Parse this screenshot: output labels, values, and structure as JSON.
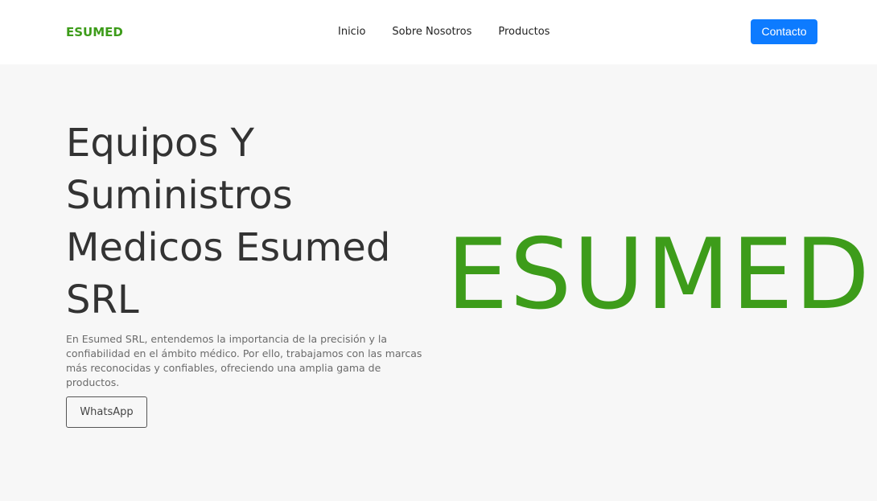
{
  "header": {
    "brand": "ESUMED",
    "nav": [
      {
        "label": "Inicio"
      },
      {
        "label": "Sobre Nosotros"
      },
      {
        "label": "Productos"
      }
    ],
    "contact_label": "Contacto"
  },
  "hero": {
    "title": "Equipos Y Suministros Medicos Esumed SRL",
    "description": "En Esumed SRL, entendemos la importancia de la precisión y la confiabilidad en el ámbito médico. Por ello, trabajamos con las marcas más reconocidas y confiables, ofreciendo una amplia gama de productos.",
    "whatsapp_label": "WhatsApp",
    "logo_text": "ESUMED"
  },
  "colors": {
    "brand_green": "#3d9c1a",
    "accent_blue": "#0d7bff",
    "hero_background": "#f7f7f7",
    "header_background": "#ffffff"
  }
}
